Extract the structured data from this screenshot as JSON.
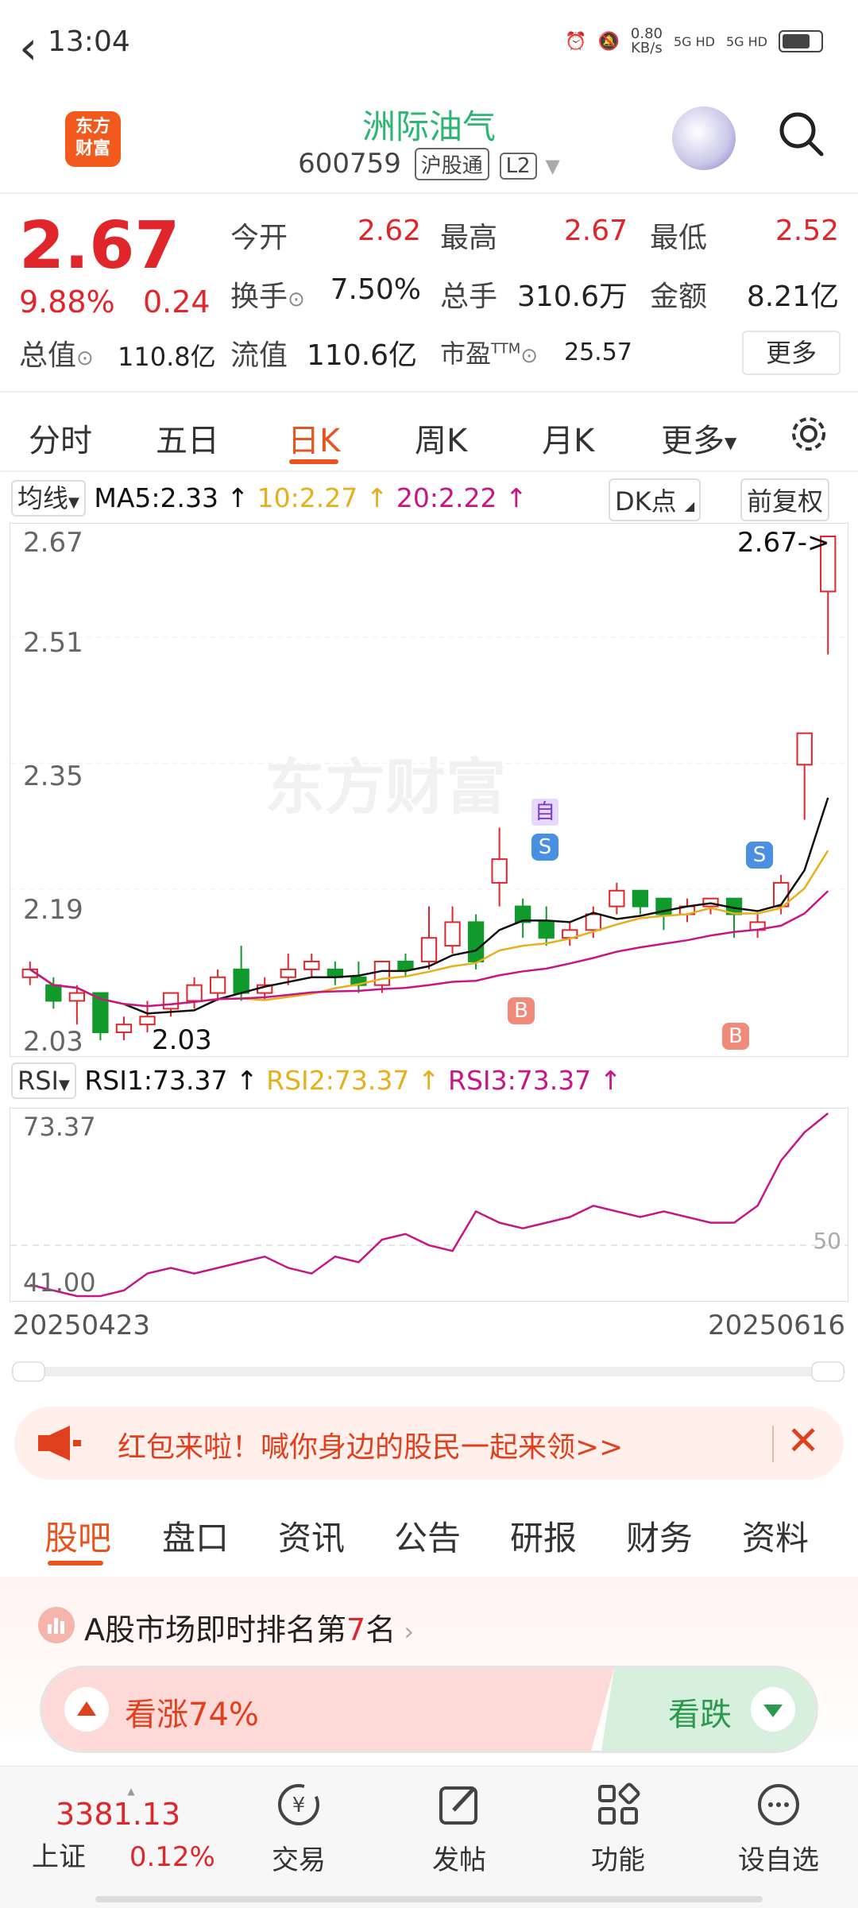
{
  "status_bar": {
    "time": "13:04",
    "net_speed": "0.80\nKB/s",
    "sig1": "5G HD",
    "sig2": "5G HD"
  },
  "header": {
    "logo_text": "东方\n财富",
    "stock_name": "洲际油气",
    "code": "600759",
    "tag": "沪股通",
    "level": "L2"
  },
  "quote": {
    "price": "2.67",
    "change_pct": "9.88%",
    "change": "0.24",
    "open_label": "今开",
    "open": "2.62",
    "high_label": "最高",
    "high": "2.67",
    "low_label": "最低",
    "low": "2.52",
    "turnover_label": "换手",
    "turnover": "7.50%",
    "volume_label": "总手",
    "volume": "310.6万",
    "amount_label": "金额",
    "amount": "8.21亿",
    "mktcap_label": "总值",
    "mktcap": "110.8亿",
    "float_label": "流值",
    "float": "110.6亿",
    "pe_label": "市盈",
    "pe_sup": "TTM",
    "pe": "25.57",
    "more": "更多"
  },
  "ktabs": [
    "分时",
    "五日",
    "日K",
    "周K",
    "月K",
    "更多"
  ],
  "active_ktab": "日K",
  "indicator": {
    "ma_select": "均线",
    "ma5": "MA5:2.33 ↑",
    "ma10": "10:2.27 ↑",
    "ma20": "20:2.22 ↑",
    "dk": "DK点",
    "fq": "前复权"
  },
  "chart_data": {
    "type": "candlestick",
    "y_ticks": [
      "2.67",
      "2.51",
      "2.35",
      "2.19",
      "2.03"
    ],
    "ylim": [
      2.03,
      2.67
    ],
    "last_price_label": "2.67->",
    "low_marker": "2.03",
    "watermark": "东方财富",
    "candles": [
      {
        "o": 2.11,
        "c": 2.12,
        "h": 2.13,
        "l": 2.1
      },
      {
        "o": 2.1,
        "c": 2.08,
        "h": 2.11,
        "l": 2.07
      },
      {
        "o": 2.08,
        "c": 2.09,
        "h": 2.1,
        "l": 2.05
      },
      {
        "o": 2.09,
        "c": 2.04,
        "h": 2.09,
        "l": 2.03
      },
      {
        "o": 2.04,
        "c": 2.05,
        "h": 2.06,
        "l": 2.03
      },
      {
        "o": 2.05,
        "c": 2.06,
        "h": 2.08,
        "l": 2.04
      },
      {
        "o": 2.07,
        "c": 2.09,
        "h": 2.09,
        "l": 2.06
      },
      {
        "o": 2.08,
        "c": 2.1,
        "h": 2.11,
        "l": 2.07
      },
      {
        "o": 2.09,
        "c": 2.11,
        "h": 2.12,
        "l": 2.08
      },
      {
        "o": 2.12,
        "c": 2.09,
        "h": 2.15,
        "l": 2.08
      },
      {
        "o": 2.09,
        "c": 2.1,
        "h": 2.11,
        "l": 2.08
      },
      {
        "o": 2.11,
        "c": 2.12,
        "h": 2.14,
        "l": 2.1
      },
      {
        "o": 2.12,
        "c": 2.13,
        "h": 2.14,
        "l": 2.11
      },
      {
        "o": 2.12,
        "c": 2.11,
        "h": 2.13,
        "l": 2.1
      },
      {
        "o": 2.11,
        "c": 2.1,
        "h": 2.13,
        "l": 2.09
      },
      {
        "o": 2.1,
        "c": 2.13,
        "h": 2.13,
        "l": 2.09
      },
      {
        "o": 2.13,
        "c": 2.12,
        "h": 2.14,
        "l": 2.11
      },
      {
        "o": 2.13,
        "c": 2.16,
        "h": 2.2,
        "l": 2.12
      },
      {
        "o": 2.15,
        "c": 2.18,
        "h": 2.2,
        "l": 2.14
      },
      {
        "o": 2.18,
        "c": 2.13,
        "h": 2.19,
        "l": 2.12
      },
      {
        "o": 2.23,
        "c": 2.26,
        "h": 2.3,
        "l": 2.2
      },
      {
        "o": 2.2,
        "c": 2.18,
        "h": 2.21,
        "l": 2.16
      },
      {
        "o": 2.18,
        "c": 2.16,
        "h": 2.2,
        "l": 2.15
      },
      {
        "o": 2.16,
        "c": 2.17,
        "h": 2.18,
        "l": 2.15
      },
      {
        "o": 2.17,
        "c": 2.19,
        "h": 2.2,
        "l": 2.16
      },
      {
        "o": 2.2,
        "c": 2.22,
        "h": 2.23,
        "l": 2.19
      },
      {
        "o": 2.22,
        "c": 2.2,
        "h": 2.22,
        "l": 2.19
      },
      {
        "o": 2.21,
        "c": 2.19,
        "h": 2.21,
        "l": 2.17
      },
      {
        "o": 2.19,
        "c": 2.2,
        "h": 2.21,
        "l": 2.18
      },
      {
        "o": 2.2,
        "c": 2.21,
        "h": 2.21,
        "l": 2.19
      },
      {
        "o": 2.21,
        "c": 2.19,
        "h": 2.21,
        "l": 2.16
      },
      {
        "o": 2.17,
        "c": 2.18,
        "h": 2.19,
        "l": 2.16
      },
      {
        "o": 2.2,
        "c": 2.23,
        "h": 2.24,
        "l": 2.19
      },
      {
        "o": 2.38,
        "c": 2.42,
        "h": 2.42,
        "l": 2.31
      },
      {
        "o": 2.6,
        "c": 2.67,
        "h": 2.67,
        "l": 2.52
      }
    ],
    "ma": [
      {
        "name": "MA5",
        "color": "#111111"
      },
      {
        "name": "MA10",
        "color": "#e5b01c"
      },
      {
        "name": "MA20",
        "color": "#c71585"
      }
    ],
    "markers": [
      {
        "text": "自"
      },
      {
        "text": "S"
      },
      {
        "text": "B"
      },
      {
        "text": "S"
      },
      {
        "text": "B"
      }
    ],
    "date_start": "20250423",
    "date_end": "20250616"
  },
  "rsi": {
    "select": "RSI",
    "rsi1": "RSI1:73.37 ↑",
    "rsi2": "RSI2:73.37 ↑",
    "rsi3": "RSI3:73.37 ↑",
    "top": "73.37",
    "bottom": "41.00",
    "mid": "50",
    "values": [
      43,
      42,
      41,
      41,
      42,
      45,
      46,
      45,
      46,
      47,
      48,
      46,
      45,
      48,
      47,
      51,
      52,
      50,
      49,
      56,
      54,
      53,
      54,
      55,
      57,
      56,
      55,
      56,
      55,
      54,
      54,
      57,
      65,
      70,
      73.37
    ]
  },
  "banner": {
    "text": "红包来啦！喊你身边的股民一起来领>>"
  },
  "btabs": [
    "股吧",
    "盘口",
    "资讯",
    "公告",
    "研报",
    "财务",
    "资料"
  ],
  "rank": {
    "text_pre": "A股市场即时排名第",
    "rank": "7",
    "text_post": "名"
  },
  "vote": {
    "up": "看涨74%",
    "down": "看跌"
  },
  "footer": {
    "index_value": "3381.13",
    "index_name": "上证",
    "index_change": "0.12%",
    "items": [
      "交易",
      "发帖",
      "功能",
      "设自选"
    ]
  },
  "colors": {
    "up": "#e0262b",
    "down": "#119a2c",
    "accent": "#e8541f",
    "name": "#2bb673"
  }
}
